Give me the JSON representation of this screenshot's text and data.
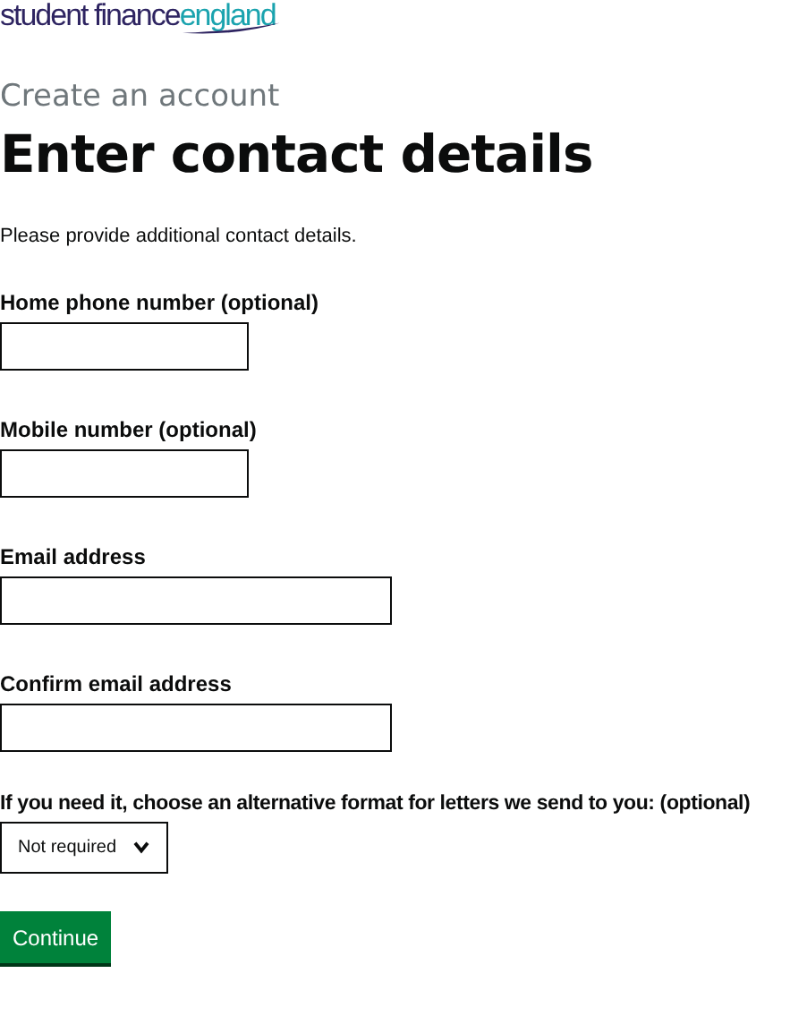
{
  "logo": {
    "part_1": "student finance",
    "part_2": "england"
  },
  "caption": "Create an account",
  "heading": "Enter contact details",
  "intro": "Please provide additional contact details.",
  "fields": [
    {
      "label": "Home phone number (optional)",
      "kind": "short"
    },
    {
      "label": "Mobile number (optional)",
      "kind": "short"
    },
    {
      "label": "Email address",
      "kind": "long"
    },
    {
      "label": "Confirm email address",
      "kind": "long"
    }
  ],
  "format_select": {
    "label": "If you need it, choose an alternative format for letters we send to you: (optional)",
    "value": "Not required"
  },
  "button": "Continue"
}
